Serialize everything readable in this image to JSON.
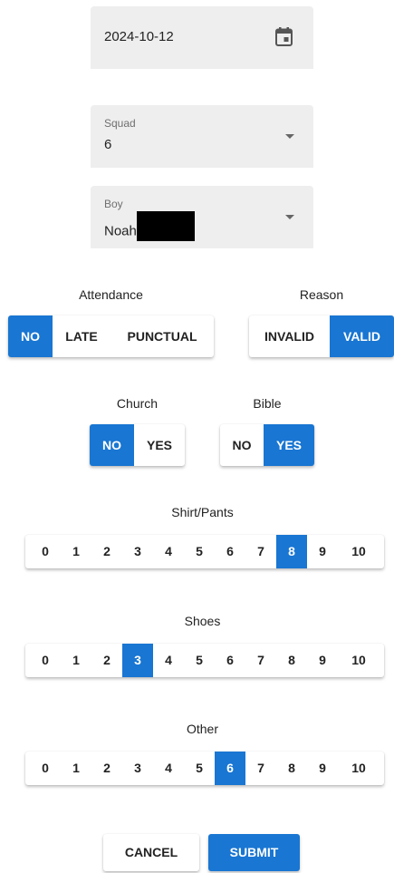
{
  "date_field": {
    "value": "2024-10-12",
    "icon": "calendar-icon"
  },
  "squad_field": {
    "label": "Squad",
    "value": "6"
  },
  "boy_field": {
    "label": "Boy",
    "value": "Noah"
  },
  "attendance": {
    "label": "Attendance",
    "options": [
      "NO",
      "LATE",
      "PUNCTUAL"
    ],
    "selected": "NO"
  },
  "reason": {
    "label": "Reason",
    "options": [
      "INVALID",
      "VALID"
    ],
    "selected": "VALID"
  },
  "church": {
    "label": "Church",
    "options": [
      "NO",
      "YES"
    ],
    "selected": "NO"
  },
  "bible": {
    "label": "Bible",
    "options": [
      "NO",
      "YES"
    ],
    "selected": "YES"
  },
  "shirt_pants": {
    "label": "Shirt/Pants",
    "options": [
      "0",
      "1",
      "2",
      "3",
      "4",
      "5",
      "6",
      "7",
      "8",
      "9",
      "10"
    ],
    "selected": "8"
  },
  "shoes": {
    "label": "Shoes",
    "options": [
      "0",
      "1",
      "2",
      "3",
      "4",
      "5",
      "6",
      "7",
      "8",
      "9",
      "10"
    ],
    "selected": "3"
  },
  "other": {
    "label": "Other",
    "options": [
      "0",
      "1",
      "2",
      "3",
      "4",
      "5",
      "6",
      "7",
      "8",
      "9",
      "10"
    ],
    "selected": "6"
  },
  "actions": {
    "cancel": "CANCEL",
    "submit": "SUBMIT"
  },
  "colors": {
    "accent": "#1976d2",
    "field_bg": "#eeeeee"
  }
}
